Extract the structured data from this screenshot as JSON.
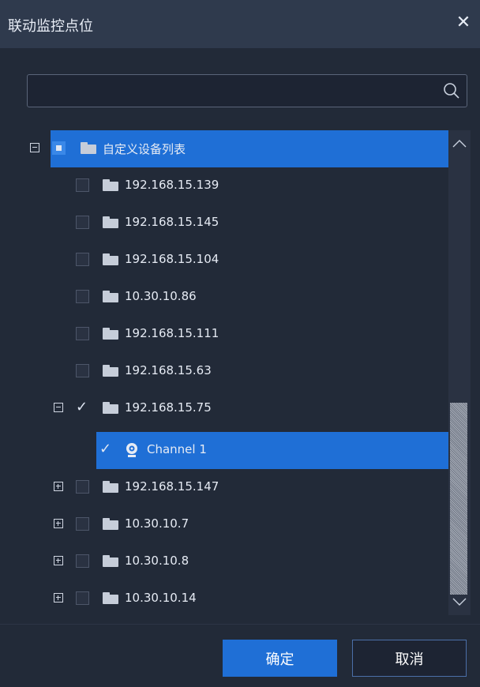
{
  "dialog": {
    "title": "联动监控点位",
    "close_label": "✕"
  },
  "search": {
    "value": "",
    "placeholder": ""
  },
  "tree": {
    "root": {
      "label": "自定义设备列表",
      "expanded": true,
      "state": "partial"
    },
    "items": [
      {
        "label": "192.168.15.139"
      },
      {
        "label": "192.168.15.145"
      },
      {
        "label": "192.168.15.104"
      },
      {
        "label": "10.30.10.86"
      },
      {
        "label": "192.168.15.111"
      },
      {
        "label": "192.168.15.63"
      },
      {
        "label": "192.168.15.75"
      },
      {
        "label": "Channel 1"
      },
      {
        "label": "192.168.15.147"
      },
      {
        "label": "10.30.10.7"
      },
      {
        "label": "10.30.10.8"
      },
      {
        "label": "10.30.10.14"
      }
    ]
  },
  "buttons": {
    "ok": "确定",
    "cancel": "取消"
  },
  "colors": {
    "accent": "#1f6fd6",
    "background": "#222a38",
    "titlebar": "#2f3a4d"
  },
  "icons": [
    "close-icon",
    "search-icon",
    "folder-icon",
    "camera-icon",
    "checkbox-icon",
    "expand-icon",
    "collapse-icon"
  ]
}
